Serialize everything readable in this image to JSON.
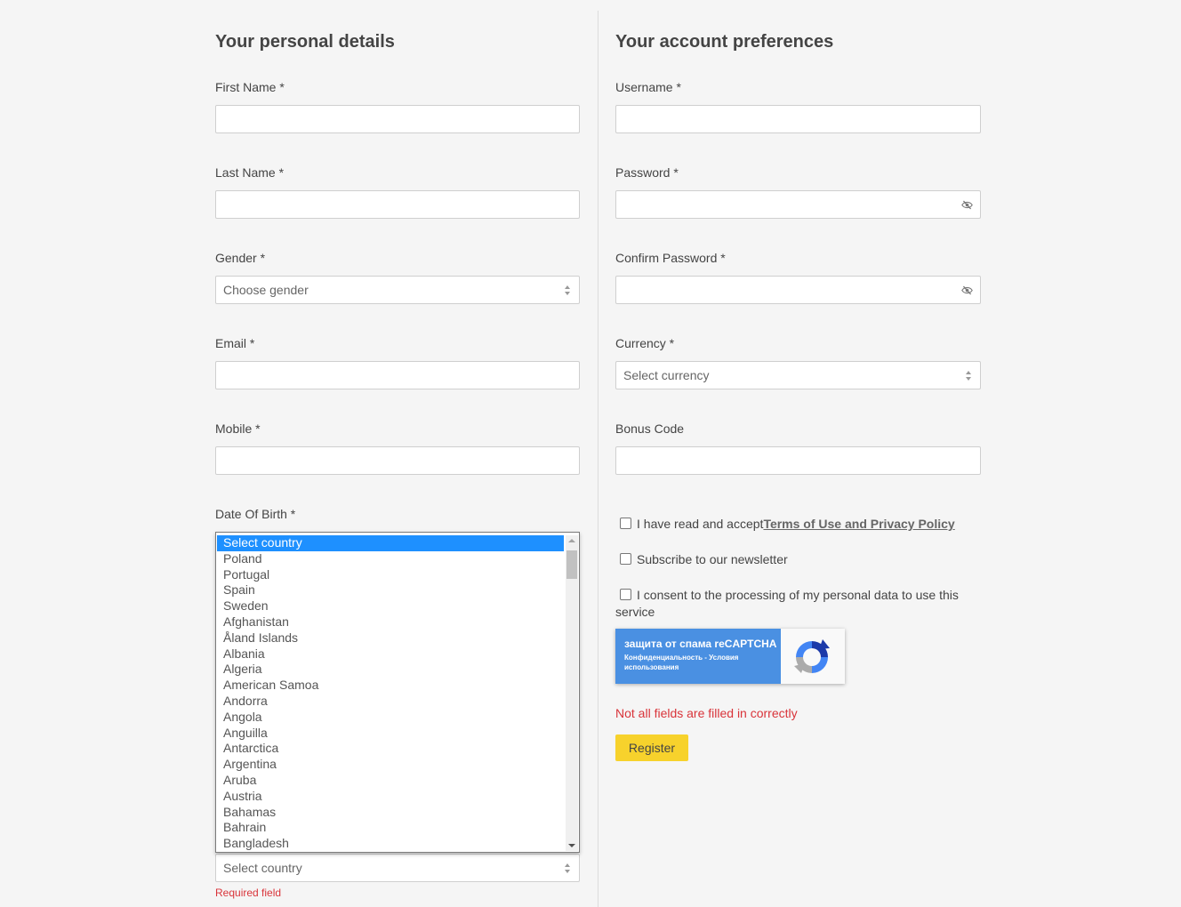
{
  "personal": {
    "heading": "Your personal details",
    "first_name_label": "First Name *",
    "last_name_label": "Last Name *",
    "gender_label": "Gender *",
    "gender_value": "Choose gender",
    "email_label": "Email *",
    "mobile_label": "Mobile *",
    "dob_label": "Date Of Birth *",
    "country_value": "Select country",
    "required_error": "Required field"
  },
  "country_list": [
    "Select country",
    "Poland",
    "Portugal",
    "Spain",
    "Sweden",
    "Afghanistan",
    "Åland Islands",
    "Albania",
    "Algeria",
    "American Samoa",
    "Andorra",
    "Angola",
    "Anguilla",
    "Antarctica",
    "Argentina",
    "Aruba",
    "Austria",
    "Bahamas",
    "Bahrain",
    "Bangladesh"
  ],
  "country_selected_index": 0,
  "account": {
    "heading": "Your account preferences",
    "username_label": "Username *",
    "password_label": "Password *",
    "confirm_password_label": "Confirm Password *",
    "currency_label": "Currency *",
    "currency_value": "Select currency",
    "bonus_code_label": "Bonus Code",
    "terms_text": "I have read and accept",
    "terms_link": "Terms of Use and Privacy Policy",
    "newsletter_text": "Subscribe to our newsletter",
    "consent_text": "I consent to the processing of my personal data to use this service",
    "recaptcha_title": "защита от спама reCAPTCHA",
    "recaptcha_sub": "Конфиденциальность - Условия использования",
    "form_error": "Not all fields are filled in correctly",
    "register_label": "Register"
  },
  "colors": {
    "background": "#f5f5f5",
    "register_button": "#f7d22c",
    "error": "#d9343a",
    "list_selection": "#1e90ff",
    "recaptcha_blue": "#4a90e2"
  },
  "icons": {
    "password_toggle": "eye-off-icon",
    "select_arrows": "sort-arrows-icon",
    "recaptcha": "recaptcha-logo-icon"
  }
}
